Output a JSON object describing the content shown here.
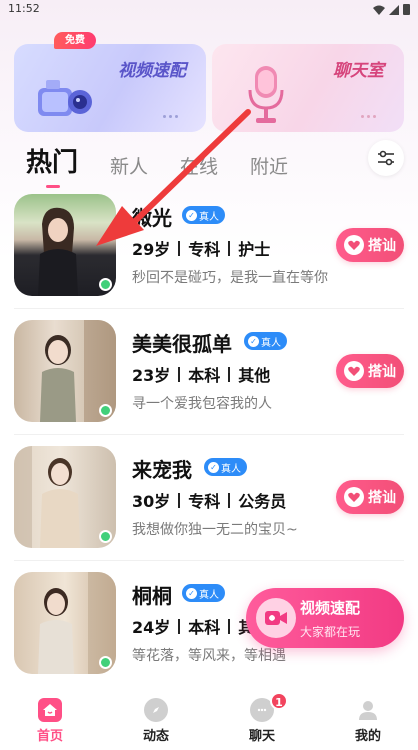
{
  "status_bar": {
    "time": "11:52"
  },
  "banners": {
    "video": {
      "title": "视频速配",
      "badge": "免费",
      "icon": "video-camera-icon"
    },
    "chat": {
      "title": "聊天室",
      "icon": "microphone-icon"
    }
  },
  "tabs": [
    {
      "label": "热门",
      "active": true
    },
    {
      "label": "新人",
      "active": false
    },
    {
      "label": "在线",
      "active": false
    },
    {
      "label": "附近",
      "active": false
    }
  ],
  "filter_icon": "sliders-icon",
  "verified_label": "真人",
  "chat_label": "搭讪",
  "users": [
    {
      "name": "微光",
      "age": "29岁",
      "education": "专科",
      "job": "护士",
      "bio": "秒回不是碰巧，是我一直在等你",
      "online": true
    },
    {
      "name": "美美很孤单",
      "age": "23岁",
      "education": "本科",
      "job": "其他",
      "bio": "寻一个爱我包容我的人",
      "online": true
    },
    {
      "name": "来宠我",
      "age": "30岁",
      "education": "专科",
      "job": "公务员",
      "bio": "我想做你独一无二的宝贝~",
      "online": true
    },
    {
      "name": "桐桐",
      "age": "24岁",
      "education": "本科",
      "job": "其他",
      "bio": "等花落，等风来，等相遇",
      "online": true
    }
  ],
  "float_video": {
    "title": "视频速配",
    "subtitle": "大家都在玩"
  },
  "bottom_nav": [
    {
      "label": "首页",
      "icon": "home-icon",
      "active": true
    },
    {
      "label": "动态",
      "icon": "compass-icon",
      "active": false
    },
    {
      "label": "聊天",
      "icon": "chat-bubble-icon",
      "active": false,
      "badge": "1"
    },
    {
      "label": "我的",
      "icon": "user-icon",
      "active": false
    }
  ],
  "colors": {
    "accent": "#ff4f86",
    "verified": "#2d8cf8",
    "online": "#41d07a",
    "arrow": "#ee3b3b"
  }
}
